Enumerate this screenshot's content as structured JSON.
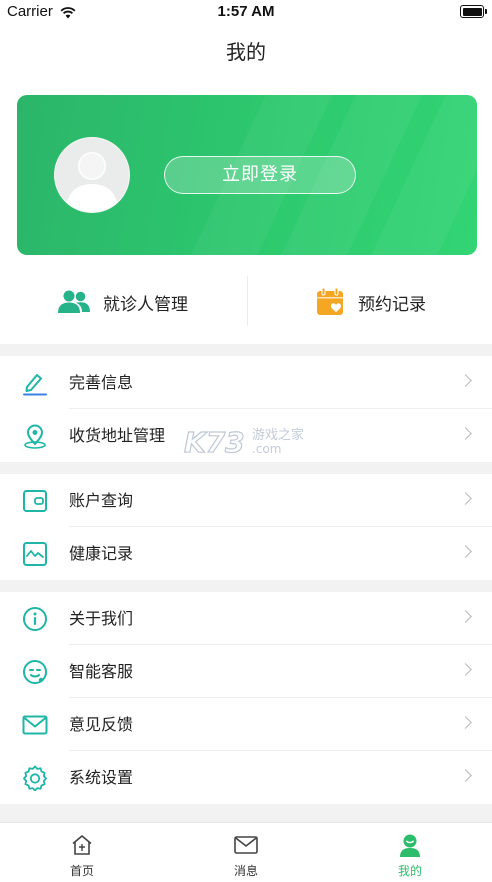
{
  "status_bar": {
    "carrier": "Carrier",
    "time": "1:57 AM"
  },
  "nav": {
    "title": "我的"
  },
  "login": {
    "button_label": "立即登录"
  },
  "quick_actions": [
    {
      "label": "就诊人管理",
      "icon": "patients-icon"
    },
    {
      "label": "预约记录",
      "icon": "calendar-icon"
    }
  ],
  "sections": [
    [
      {
        "label": "完善信息",
        "icon": "edit-icon"
      },
      {
        "label": "收货地址管理",
        "icon": "location-icon"
      }
    ],
    [
      {
        "label": "账户查询",
        "icon": "wallet-icon"
      },
      {
        "label": "健康记录",
        "icon": "health-chart-icon"
      }
    ],
    [
      {
        "label": "关于我们",
        "icon": "info-icon"
      },
      {
        "label": "智能客服",
        "icon": "service-icon"
      },
      {
        "label": "意见反馈",
        "icon": "mail-icon"
      },
      {
        "label": "系统设置",
        "icon": "gear-icon"
      }
    ]
  ],
  "watermark": {
    "brand": "K73",
    "text": "游戏之家",
    "domain": ".com"
  },
  "tabs": [
    {
      "label": "首页",
      "icon": "home-icon",
      "active": false
    },
    {
      "label": "消息",
      "icon": "message-icon",
      "active": false
    },
    {
      "label": "我的",
      "icon": "profile-icon",
      "active": true
    }
  ],
  "colors": {
    "accent": "#2bbd6b",
    "teal": "#1fb5a7",
    "orange": "#f5a623",
    "gap": "#f2f2f2"
  }
}
